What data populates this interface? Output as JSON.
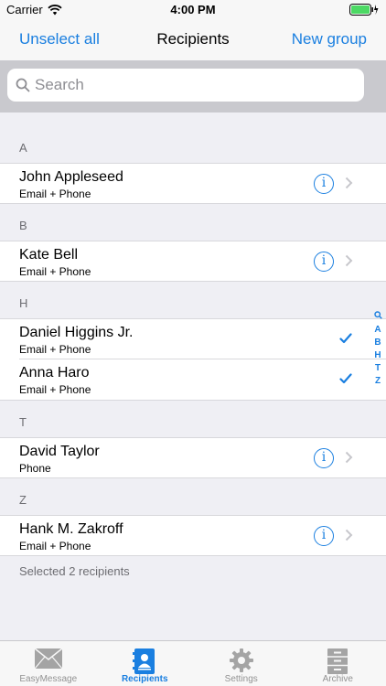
{
  "status_bar": {
    "carrier": "Carrier",
    "time": "4:00 PM"
  },
  "nav": {
    "left_button": "Unselect all",
    "title": "Recipients",
    "right_button": "New group"
  },
  "search": {
    "placeholder": "Search",
    "value": ""
  },
  "sections": [
    {
      "letter": "A",
      "contacts": [
        {
          "name": "John Appleseed",
          "detail": "Email + Phone",
          "selected": false
        }
      ]
    },
    {
      "letter": "B",
      "contacts": [
        {
          "name": "Kate Bell",
          "detail": "Email + Phone",
          "selected": false
        }
      ]
    },
    {
      "letter": "H",
      "contacts": [
        {
          "name": "Daniel Higgins Jr.",
          "detail": "Email + Phone",
          "selected": true
        },
        {
          "name": "Anna Haro",
          "detail": "Email + Phone",
          "selected": true
        }
      ]
    },
    {
      "letter": "T",
      "contacts": [
        {
          "name": "David Taylor",
          "detail": "Phone",
          "selected": false
        }
      ]
    },
    {
      "letter": "Z",
      "contacts": [
        {
          "name": "Hank M. Zakroff",
          "detail": "Email + Phone",
          "selected": false
        }
      ]
    }
  ],
  "footer": "Selected 2 recipients",
  "index": [
    "A",
    "B",
    "H",
    "T",
    "Z"
  ],
  "tabs": [
    {
      "label": "EasyMessage",
      "icon": "envelope-icon",
      "active": false
    },
    {
      "label": "Recipients",
      "icon": "contacts-book-icon",
      "active": true
    },
    {
      "label": "Settings",
      "icon": "gear-icon",
      "active": false
    },
    {
      "label": "Archive",
      "icon": "archive-cabinet-icon",
      "active": false
    }
  ],
  "colors": {
    "accent": "#1a7fe0",
    "inactive_tab": "#929292"
  }
}
